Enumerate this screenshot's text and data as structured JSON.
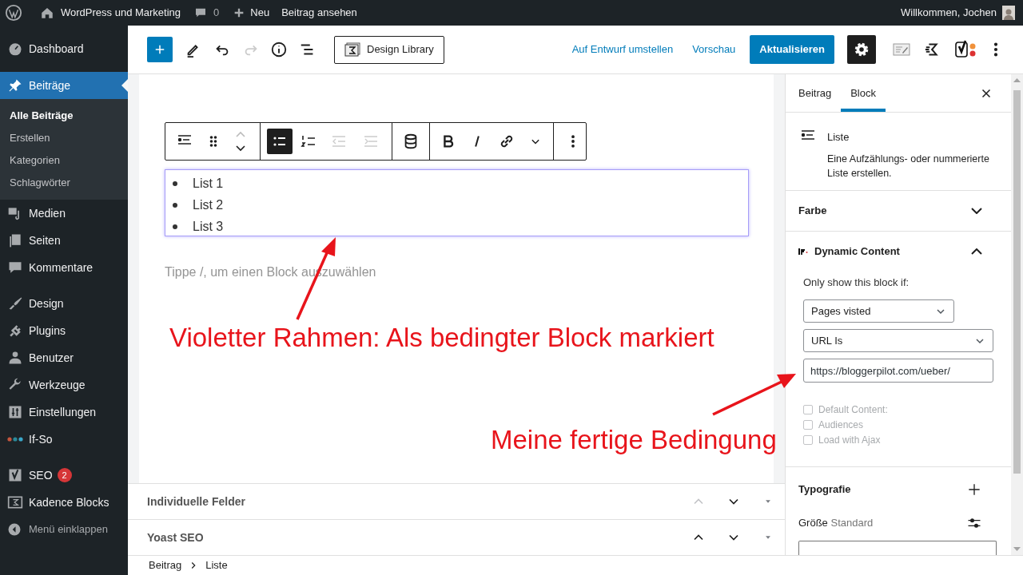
{
  "admin_bar": {
    "site_title": "WordPress und Marketing",
    "comments_count": "0",
    "new_label": "Neu",
    "view_label": "Beitrag ansehen",
    "greeting": "Willkommen, Jochen"
  },
  "sidebar": {
    "items": [
      {
        "label": "Dashboard",
        "selected": false
      },
      {
        "label": "Beiträge",
        "selected": true,
        "children": [
          {
            "label": "Alle Beiträge",
            "selected": true
          },
          {
            "label": "Erstellen",
            "selected": false
          },
          {
            "label": "Kategorien",
            "selected": false
          },
          {
            "label": "Schlagwörter",
            "selected": false
          }
        ]
      },
      {
        "label": "Medien",
        "selected": false
      },
      {
        "label": "Seiten",
        "selected": false
      },
      {
        "label": "Kommentare",
        "selected": false
      },
      {
        "label": "Design",
        "selected": false
      },
      {
        "label": "Plugins",
        "selected": false
      },
      {
        "label": "Benutzer",
        "selected": false
      },
      {
        "label": "Werkzeuge",
        "selected": false
      },
      {
        "label": "Einstellungen",
        "selected": false
      },
      {
        "label": "If-So",
        "selected": false
      },
      {
        "label": "SEO",
        "selected": false,
        "badge": "2"
      },
      {
        "label": "Kadence Blocks",
        "selected": false
      }
    ],
    "collapse_label": "Menü einklappen"
  },
  "editor_header": {
    "history": [
      {
        "kind": "undo",
        "disabled": false
      },
      {
        "kind": "redo",
        "disabled": true
      }
    ],
    "design_library": "Design Library",
    "switch_to_draft": "Auf Entwurf umstellen",
    "preview": "Vorschau",
    "update": "Aktualisieren",
    "settings_pressed": true
  },
  "block_toolbar": {
    "list_types": [
      {
        "kind": "bulleted",
        "selected": true
      },
      {
        "kind": "numbered",
        "selected": false
      }
    ],
    "indent_buttons": [
      {
        "kind": "outdent",
        "disabled": true
      },
      {
        "kind": "indent",
        "disabled": true
      }
    ]
  },
  "list_block": {
    "conditional": true,
    "items": [
      "List 1",
      "List 2",
      "List 3"
    ]
  },
  "placeholder": "Tippe /, um einen Block auszuwählen",
  "annotations": [
    "Violetter Rahmen: Als bedingter Block markiert",
    "Meine fertige Bedingung"
  ],
  "meta_boxes": [
    {
      "title": "Individuelle Felder",
      "move_up_disabled": true
    },
    {
      "title": "Yoast SEO",
      "move_up_disabled": false
    }
  ],
  "breadcrumb": [
    "Beitrag",
    "Liste"
  ],
  "settings_sidebar": {
    "tabs": [
      {
        "label": "Beitrag",
        "selected": false
      },
      {
        "label": "Block",
        "selected": true
      }
    ],
    "block_card": {
      "title": "Liste",
      "description": "Eine Aufzählungs- oder nummerierte Liste erstellen."
    },
    "color_panel": {
      "title": "Farbe",
      "expanded": false
    },
    "dynamic_content": {
      "title": "Dynamic Content",
      "expanded": true,
      "label": "Only show this block if:",
      "selects": [
        "Pages visted",
        "URL Is"
      ],
      "url_value": "https://bloggerpilot.com/ueber/",
      "checkboxes": [
        {
          "label": "Default Content:",
          "checked": false,
          "disabled": true
        },
        {
          "label": "Audiences",
          "checked": false,
          "disabled": true
        },
        {
          "label": "Load with Ajax",
          "checked": false,
          "disabled": true
        }
      ]
    },
    "typography": {
      "title": "Typografie",
      "size_label": "Größe",
      "size_value": "Standard"
    }
  }
}
